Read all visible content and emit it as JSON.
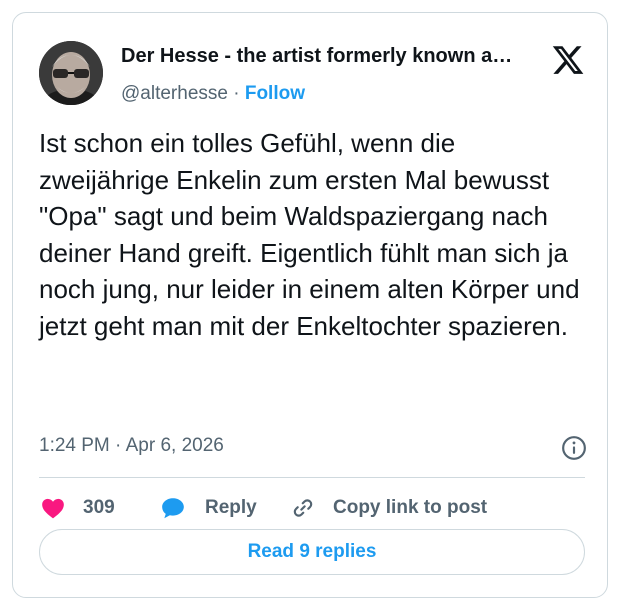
{
  "tweet": {
    "author_name": "Der Hesse - the artist formerly known a…",
    "handle": "@alterhesse",
    "separator": "·",
    "follow_label": "Follow",
    "text": "Ist schon ein tolles Gefühl, wenn die zweijährige Enkelin zum ersten Mal bewusst \"Opa\" sagt und beim Waldspaziergang nach deiner Hand greift. Eigentlich fühlt man sich ja noch jung, nur leider in einem alten Körper und jetzt geht man mit der Enkeltochter spazieren.",
    "timestamp": "1:24 PM · Apr 6, 2026"
  },
  "actions": {
    "like_count": "309",
    "reply_label": "Reply",
    "copy_label": "Copy link to post"
  },
  "read_replies_label": "Read 9 replies",
  "icons": {
    "logo": "x-logo-icon",
    "info": "info-icon",
    "like": "heart-icon",
    "reply": "speech-bubble-icon",
    "copy": "link-icon"
  },
  "colors": {
    "accent": "#1d9bf0",
    "like": "#f91880",
    "text": "#0f1419",
    "secondary": "#536471",
    "border": "#cfd9de"
  }
}
